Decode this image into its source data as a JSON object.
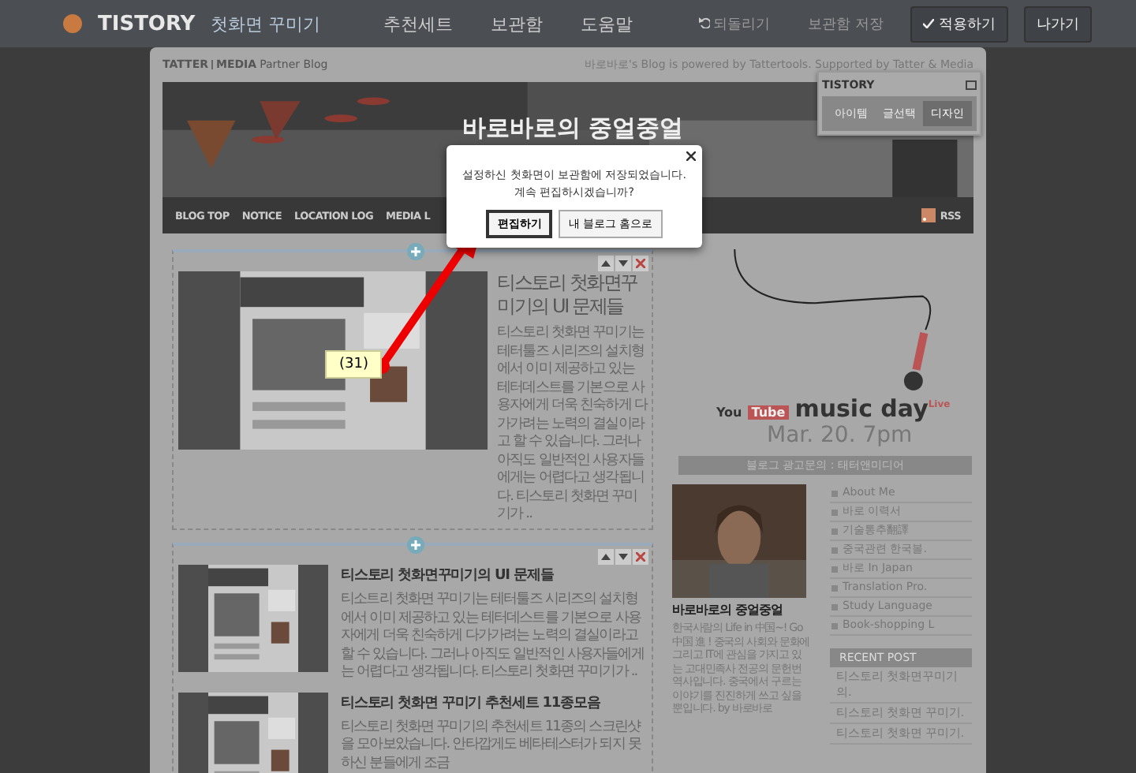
{
  "topbar": {
    "logo": "TISTORY",
    "title": "첫화면 꾸미기",
    "nav": [
      "추천세트",
      "보관함",
      "도움말"
    ],
    "actions": [
      {
        "kind": "undo",
        "label": "되돌리기"
      },
      {
        "kind": "plain",
        "label": "보관함 저장"
      },
      {
        "kind": "apply",
        "label": "적용하기"
      },
      {
        "kind": "button",
        "label": "나가기"
      }
    ]
  },
  "blog": {
    "partner": {
      "brand_left": "TATTER",
      "brand_right": "MEDIA",
      "label": "Partner Blog"
    },
    "powered": "바로바로's Blog is powered by Tattertools. Supported by Tatter & Media",
    "title": "바로바로의 중얼중얼",
    "nav": [
      "BLOG TOP",
      "NOTICE",
      "LOCATION LOG",
      "MEDIA L"
    ],
    "rss": "RSS"
  },
  "tistory_panel": {
    "logo": "TISTORY",
    "tabs": [
      {
        "label": "아이템",
        "selected": false
      },
      {
        "label": "글선택",
        "selected": false
      },
      {
        "label": "디자인",
        "selected": true
      }
    ]
  },
  "dialog": {
    "message": "설정하신 첫화면이 보관함에 저장되었습니다.\n계속 편집하시겠습니까?",
    "buttons": [
      {
        "label": "편집하기",
        "selected": true
      },
      {
        "label": "내 블로그 홈으로",
        "selected": false
      }
    ]
  },
  "callout": "(31)",
  "featured": {
    "title": "티스토리 첫화면꾸미기의 UI 문제들",
    "excerpt": "티스토리 첫화면 꾸미기는 테터툴즈 시리즈의 설치형에서 이미 제공하고 있는 테터데스트를 기본으로 사용자에게 더욱 친숙하게 다가가려는 노력의 결실이라고 할 수 있습니다. 그러나 아직도 일반적인 사용자들에게는 어렵다고 생각됩니다. 티스토리 첫화면 꾸미기가 .."
  },
  "posts": [
    {
      "title": "티스토리 첫화면꾸미기의 UI 문제들",
      "excerpt": "티소트리 첫화면 꾸미기는 테터툴즈 시리즈의 설치형에서 이미 제공하고 있는 테터데스트를 기본으로 사용자에게 더욱 친숙하게 다가가려는 노력의 결실이라고 할 수 있습니다. 그러나 아직도 일반적인 사용자들에게는 어렵다고 생각됩니다. 티스토리 첫화면 꾸미기가 .."
    },
    {
      "title": "티스토리 첫화면 꾸미기 추천세트 11종모음",
      "excerpt": "티스토리 첫화면 꾸미기의 추천세트 11종의 스크린샷을 모아보았습니다. 안타깝게도 베타테스터가 되지 못하신 분들에게 조금"
    }
  ],
  "ad": {
    "brand_a": "You",
    "brand_b": "Tube",
    "title": "music day",
    "badge": "Live",
    "date": "Mar. 20. 7pm",
    "inquiry": "블로그 광고문의 : 태터앤미디어"
  },
  "profile": {
    "name": "바로바로의 중얼중얼",
    "bio": "한국사람의 Life in 中国~! Go 中国 進 ! 중국의 사회와 문화에 그리고 IT에 관심을 가지고 있는 고대민족사 전공의 문헌번역사입니다. 중국에서 구르는 이야기를 진진하게 쓰고 싶을 뿐입니다. by 바로바로"
  },
  "categories": [
    "About Me",
    "바로 이력서",
    "기술통추翻譯",
    "중국관련 한국볼.",
    "바로 In Japan",
    "Translation Pro.",
    "Study Language",
    "Book-shopping L"
  ],
  "recent": {
    "heading": "RECENT POST",
    "items": [
      "티스토리 첫화면꾸미기의.",
      "티스토리 첫화면 꾸미기.",
      "티스토리 첫화면 꾸미기."
    ]
  }
}
